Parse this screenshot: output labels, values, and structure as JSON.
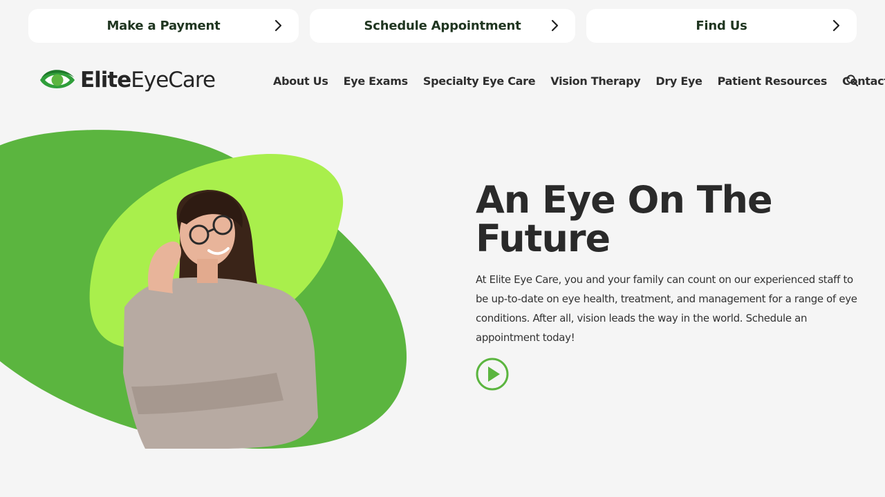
{
  "topbar": {
    "payment_label": "Make a Payment",
    "appointment_label": "Schedule Appointment",
    "find_label": "Find Us"
  },
  "logo": {
    "name_bold": "Elite",
    "name_regular": "EyeCare"
  },
  "nav": {
    "items": [
      "About Us",
      "Eye Exams",
      "Specialty Eye Care",
      "Vision Therapy",
      "Dry Eye",
      "Patient Resources",
      "Contact"
    ]
  },
  "hero": {
    "title_line1": "An Eye On The",
    "title_line2": "Future",
    "text": "At Elite Eye Care, you and your family can count on our experienced staff to be up-to-date on eye health, treatment, and management for a range of eye conditions. After all, vision leads the way in the world. Schedule an appointment today!"
  },
  "colors": {
    "green_dark": "#5bb53f",
    "green_light": "#a9ef4c",
    "text": "#2a2a2a",
    "background": "#f5f5f5"
  },
  "icons": {
    "chevron": "chevron-right-icon",
    "search": "search-icon",
    "play": "play-icon",
    "logo": "eye-logo-icon"
  }
}
